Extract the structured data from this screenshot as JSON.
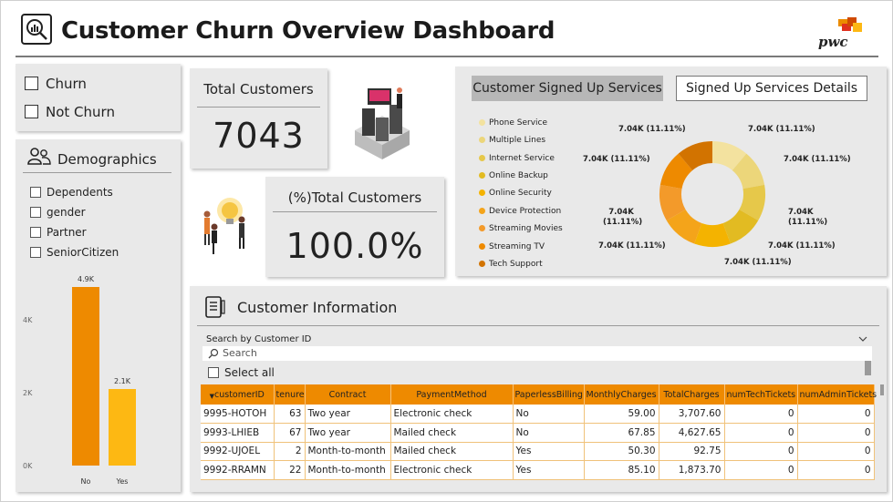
{
  "header": {
    "title": "Customer Churn Overview Dashboard",
    "brand": "pwc",
    "brand_colors": [
      "#fdb813",
      "#e0301e",
      "#eb8c00",
      "#d93954"
    ]
  },
  "churn_filter": {
    "options": [
      "Churn",
      "Not Churn"
    ]
  },
  "demographics": {
    "title": "Demographics",
    "options": [
      "Dependents",
      "gender",
      "Partner",
      "SeniorCitizen"
    ],
    "chart": {
      "type": "bar",
      "categories": [
        "No",
        "Yes"
      ],
      "values": [
        4900,
        2100
      ],
      "data_labels": [
        "4.9K",
        "2.1K"
      ],
      "y_ticks": [
        "0K",
        "2K",
        "4K"
      ],
      "ylim": [
        0,
        5600
      ],
      "colors": [
        "#ee8a00",
        "#fdb813"
      ]
    }
  },
  "kpis": {
    "total_customers": {
      "label": "Total Customers",
      "value": "7043"
    },
    "pct_total_customers": {
      "label": "(%)Total Customers",
      "value": "100.0%"
    }
  },
  "services": {
    "tabs": [
      "Customer Signed Up Services",
      "Signed Up Services Details"
    ],
    "legend": [
      {
        "label": "Phone Service",
        "color": "#f3e29f"
      },
      {
        "label": "Multiple Lines",
        "color": "#ecd67a"
      },
      {
        "label": "Internet Service",
        "color": "#e6c84a"
      },
      {
        "label": "Online Backup",
        "color": "#e2bb22"
      },
      {
        "label": "Online Security",
        "color": "#f4b300"
      },
      {
        "label": "Device Protection",
        "color": "#f4a41a"
      },
      {
        "label": "Streaming Movies",
        "color": "#f39a2a"
      },
      {
        "label": "Streaming TV",
        "color": "#ee8a00"
      },
      {
        "label": "Tech Support",
        "color": "#d27300"
      }
    ]
  },
  "chart_data": {
    "type": "pie",
    "categories": [
      "Phone Service",
      "Multiple Lines",
      "Internet Service",
      "Online Backup",
      "Online Security",
      "Device Protection",
      "Streaming Movies",
      "Streaming TV",
      "Tech Support"
    ],
    "values": [
      7043,
      7043,
      7043,
      7043,
      7043,
      7043,
      7043,
      7043,
      7043
    ],
    "labels": [
      "7.04K (11.11%)",
      "7.04K (11.11%)",
      "7.04K (11.11%)",
      "7.04K (11.11%)",
      "7.04K (11.11%)",
      "7.04K (11.11%)",
      "7.04K (11.11%)",
      "7.04K (11.11%)",
      "7.04K (11.11%)"
    ]
  },
  "customer_info": {
    "title": "Customer Information",
    "search_label": "Search by Customer ID",
    "search_placeholder": "Search",
    "select_all": "Select all",
    "columns": [
      "customerID",
      "tenure",
      "Contract",
      "PaymentMethod",
      "PaperlessBilling",
      "MonthlyCharges",
      "TotalCharges",
      "numTechTickets",
      "numAdminTickets"
    ],
    "rows": [
      [
        "9995-HOTOH",
        "63",
        "Two year",
        "Electronic check",
        "No",
        "59.00",
        "3,707.60",
        "0",
        "0"
      ],
      [
        "9993-LHIEB",
        "67",
        "Two year",
        "Mailed check",
        "No",
        "67.85",
        "4,627.65",
        "0",
        "0"
      ],
      [
        "9992-UJOEL",
        "2",
        "Month-to-month",
        "Mailed check",
        "Yes",
        "50.30",
        "92.75",
        "0",
        "0"
      ],
      [
        "9992-RRAMN",
        "22",
        "Month-to-month",
        "Electronic check",
        "Yes",
        "85.10",
        "1,873.70",
        "0",
        "0"
      ]
    ]
  }
}
